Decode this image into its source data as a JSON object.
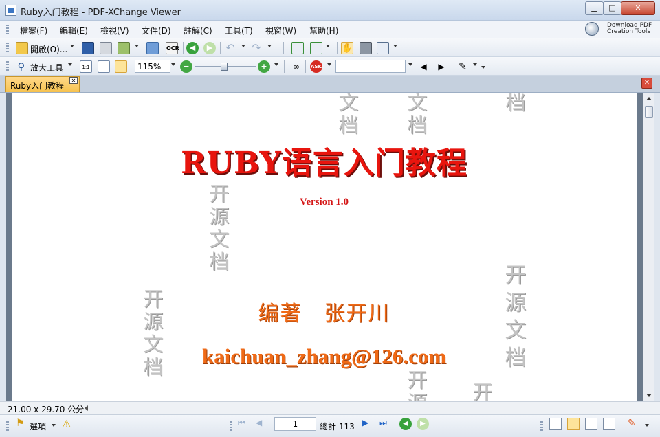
{
  "window": {
    "title": "Ruby入门教程 - PDF-XChange Viewer",
    "min": "▁",
    "max": "□",
    "close": "✕",
    "download_line1": "Download PDF",
    "download_line2": "Creation Tools"
  },
  "menu": [
    "檔案(F)",
    "編輯(E)",
    "檢視(V)",
    "文件(D)",
    "註解(C)",
    "工具(T)",
    "視窗(W)",
    "幫助(H)"
  ],
  "toolbar1": {
    "open_label": "開啟(O)...",
    "ocr_label": "OCR"
  },
  "toolbar2": {
    "zoom_tool_label": "放大工具",
    "zoom_value": "115%",
    "search_value": ""
  },
  "tabs": [
    {
      "label": "Ruby入门教程",
      "close": "✕"
    }
  ],
  "tab_close": "✕",
  "document": {
    "title": "RUBY语言入门教程",
    "version": "Version 1.0",
    "author": "编著　张开川",
    "email": "kaichuan_zhang@126.com",
    "watermark": "开源文档",
    "watermark_chars": [
      "开",
      "源",
      "文",
      "档"
    ]
  },
  "page_size": "21.00 x 29.70 公分",
  "status": {
    "options_label": "選項",
    "current_page": "1",
    "total_label": "總計 113"
  },
  "colors": {
    "title_red": "#e8150e",
    "author_orange": "#f06a16",
    "tab_yellow": "#f6c24f",
    "watermark_gray": "#c3c3c3"
  }
}
